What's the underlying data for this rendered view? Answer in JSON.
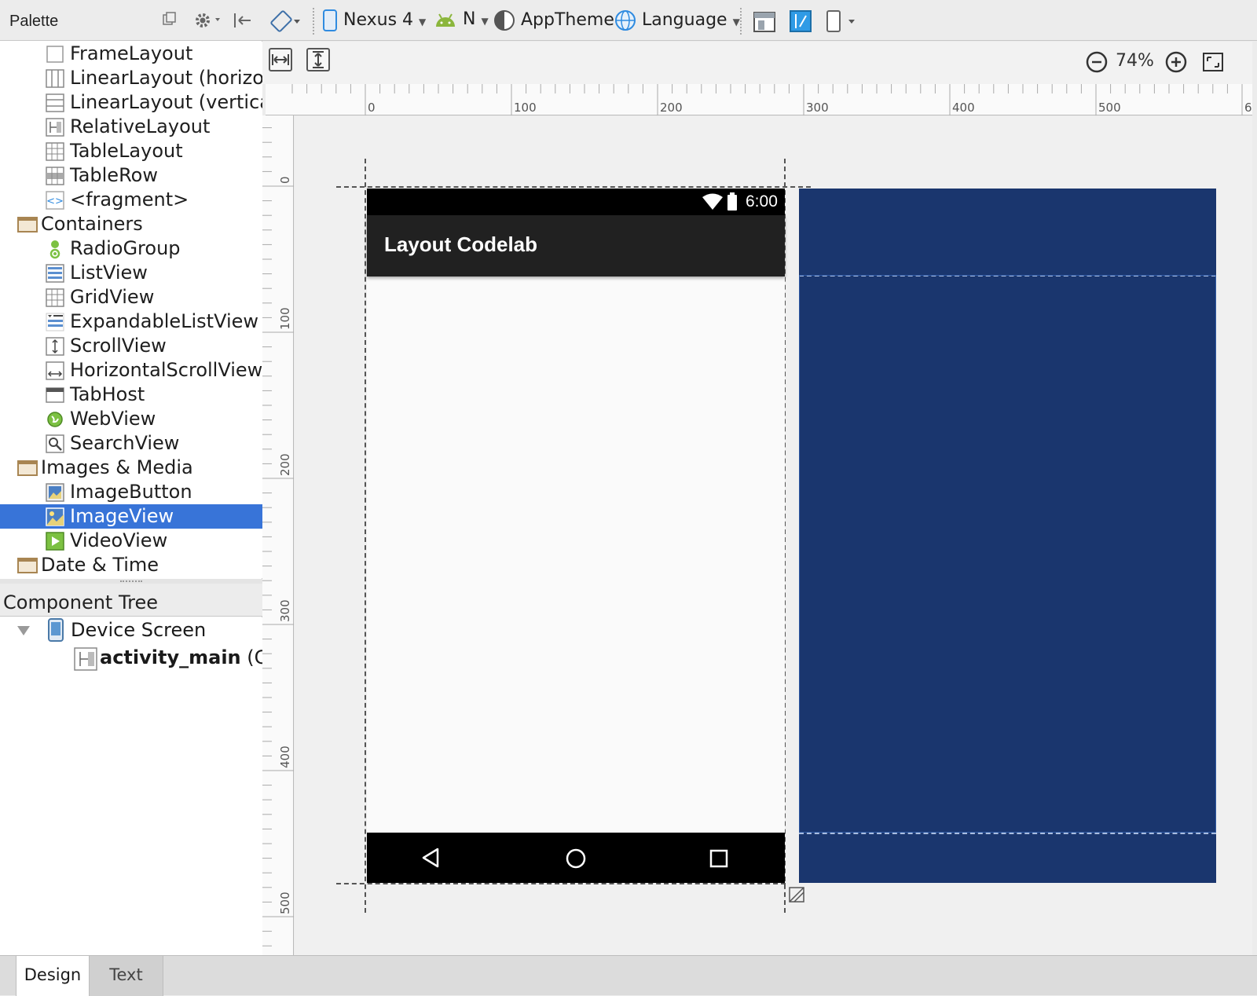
{
  "palette": {
    "title": "Palette",
    "items": [
      {
        "label": "FrameLayout",
        "kind": "item",
        "icon": "frame-layout-icon"
      },
      {
        "label": "LinearLayout (horizor",
        "kind": "item",
        "icon": "linear-layout-horizontal-icon"
      },
      {
        "label": "LinearLayout (vertica",
        "kind": "item",
        "icon": "linear-layout-vertical-icon"
      },
      {
        "label": "RelativeLayout",
        "kind": "item",
        "icon": "relative-layout-icon"
      },
      {
        "label": "TableLayout",
        "kind": "item",
        "icon": "table-layout-icon"
      },
      {
        "label": "TableRow",
        "kind": "item",
        "icon": "table-row-icon"
      },
      {
        "label": "<fragment>",
        "kind": "item",
        "icon": "fragment-icon"
      },
      {
        "label": "Containers",
        "kind": "category",
        "icon": "folder-icon"
      },
      {
        "label": "RadioGroup",
        "kind": "item",
        "icon": "radio-group-icon"
      },
      {
        "label": "ListView",
        "kind": "item",
        "icon": "list-view-icon"
      },
      {
        "label": "GridView",
        "kind": "item",
        "icon": "grid-view-icon"
      },
      {
        "label": "ExpandableListView",
        "kind": "item",
        "icon": "expandable-list-view-icon"
      },
      {
        "label": "ScrollView",
        "kind": "item",
        "icon": "scroll-view-icon"
      },
      {
        "label": "HorizontalScrollView",
        "kind": "item",
        "icon": "horizontal-scroll-view-icon"
      },
      {
        "label": "TabHost",
        "kind": "item",
        "icon": "tab-host-icon"
      },
      {
        "label": "WebView",
        "kind": "item",
        "icon": "web-view-icon"
      },
      {
        "label": "SearchView",
        "kind": "item",
        "icon": "search-view-icon"
      },
      {
        "label": "Images & Media",
        "kind": "category",
        "icon": "folder-icon"
      },
      {
        "label": "ImageButton",
        "kind": "item",
        "icon": "image-button-icon"
      },
      {
        "label": "ImageView",
        "kind": "item",
        "icon": "image-view-icon",
        "selected": true
      },
      {
        "label": "VideoView",
        "kind": "item",
        "icon": "video-view-icon"
      },
      {
        "label": "Date & Time",
        "kind": "category",
        "icon": "folder-icon"
      }
    ]
  },
  "component_tree": {
    "title": "Component Tree",
    "root": "Device Screen",
    "child_name": "activity_main",
    "child_suffix": " (Cc"
  },
  "toolbar": {
    "device": "Nexus 4",
    "api": "N",
    "theme": "AppTheme",
    "language": "Language",
    "zoom": "74%"
  },
  "rulers": {
    "horizontal": [
      "0",
      "100",
      "200",
      "300",
      "400",
      "500",
      "6"
    ],
    "vertical": [
      "0",
      "100",
      "200",
      "300",
      "400",
      "500"
    ]
  },
  "phone": {
    "time": "6:00",
    "app_title": "Layout Codelab"
  },
  "tabs": {
    "design": "Design",
    "text": "Text"
  },
  "colors": {
    "selection": "#3874d8",
    "blueprint": "#1a366e",
    "app_bar": "#212121",
    "status_bar": "#000000"
  }
}
